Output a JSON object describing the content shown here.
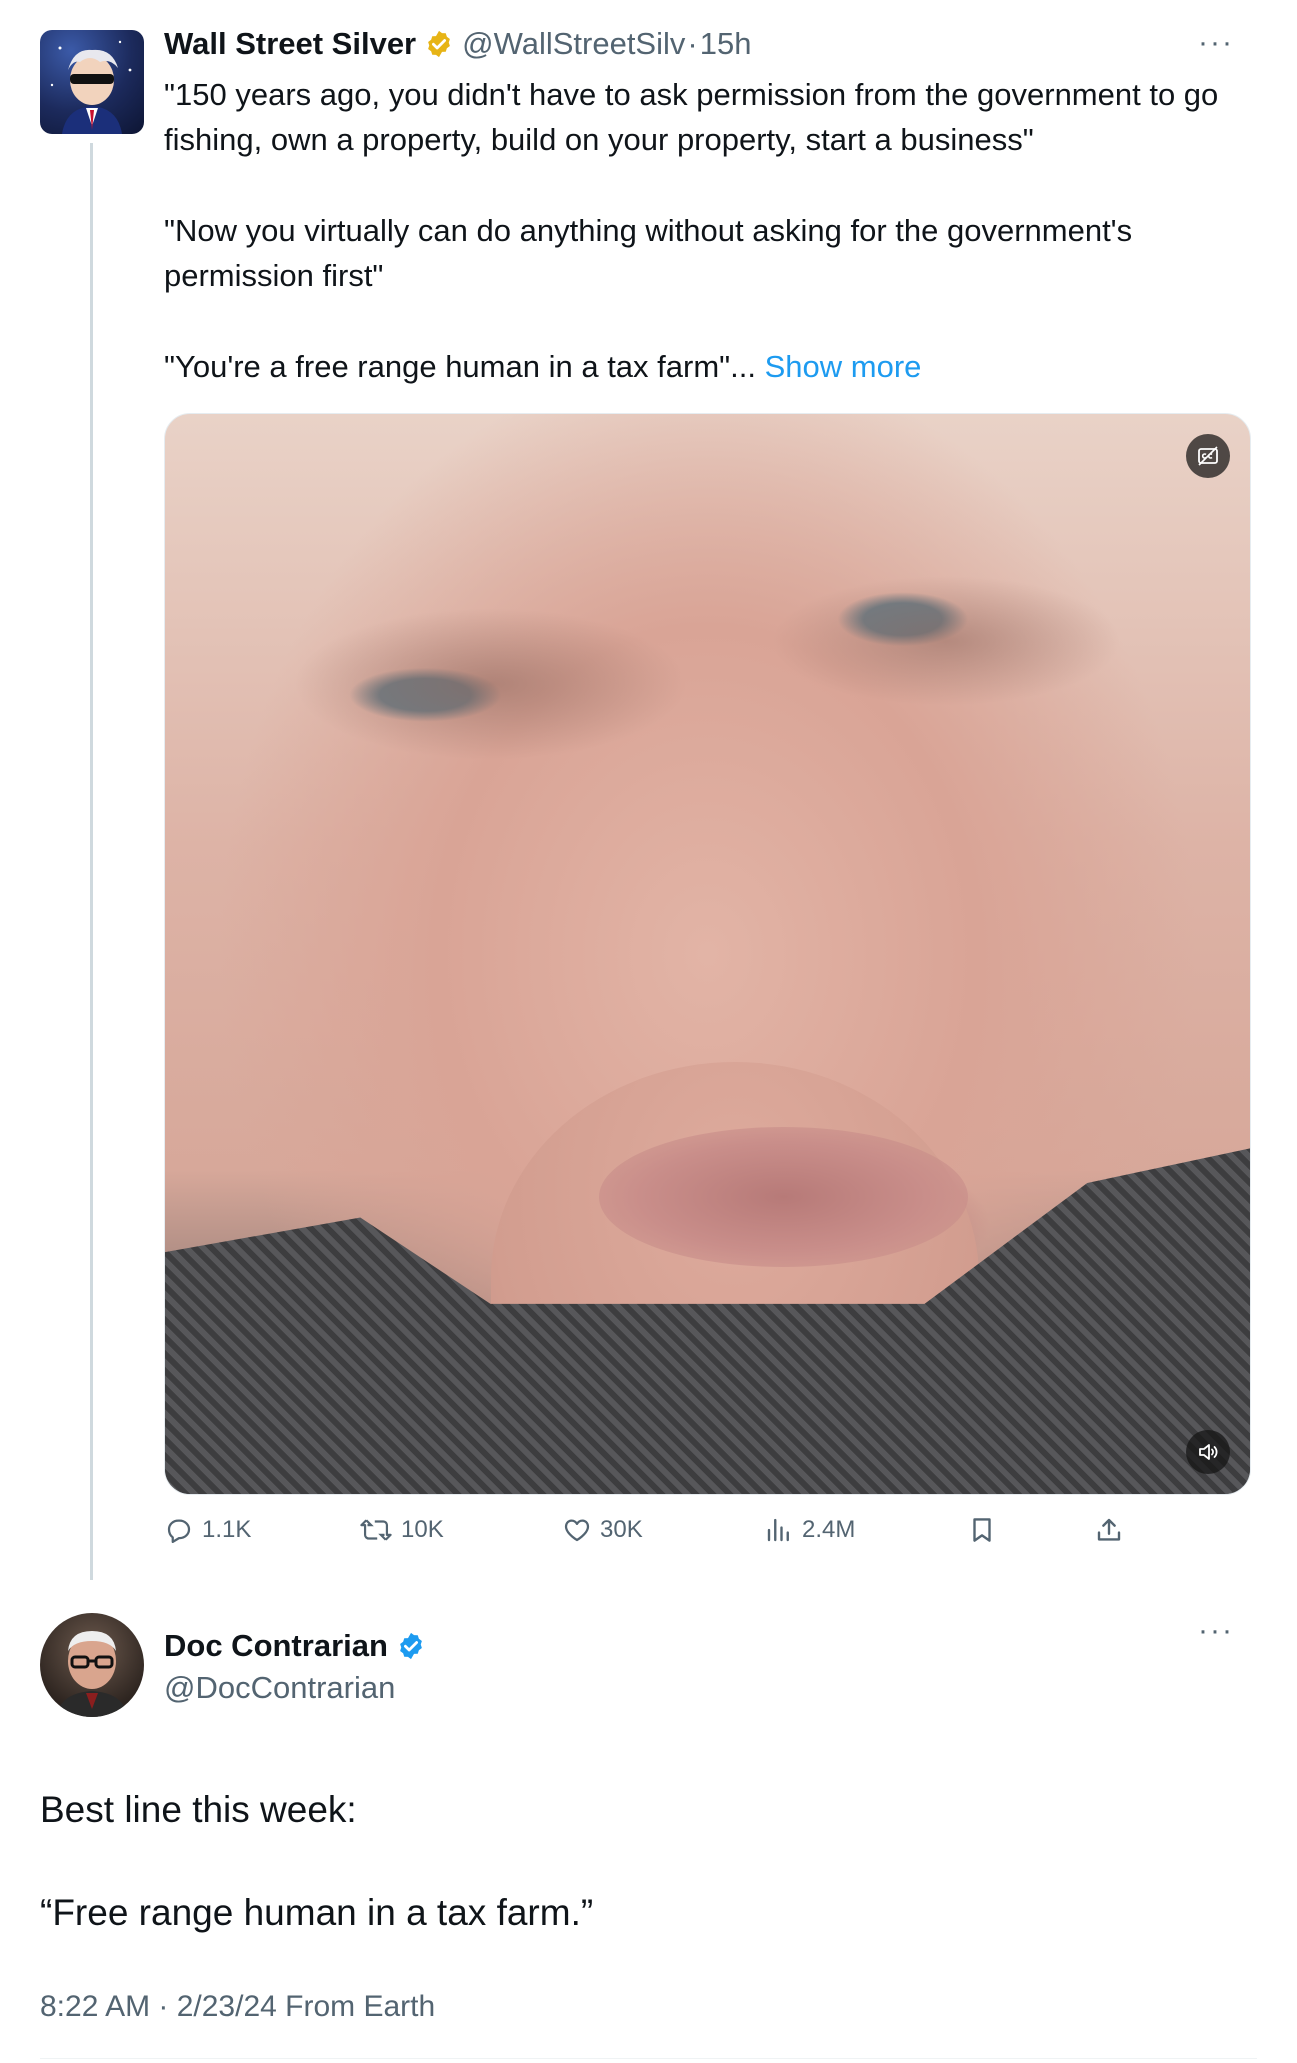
{
  "tweet": {
    "author_name": "Wall Street Silver",
    "author_handle": "@WallStreetSilv",
    "separator": "·",
    "time_ago": "15h",
    "verified_badge_color": "#e7b416",
    "paragraphs": [
      "\"150 years ago, you didn't have to ask permission from the government to go fishing, own a property, build on your property, start a business\"",
      "\"Now you virtually can do anything without asking for the government's permission first\"",
      "\"You're a free range human in a tax farm\"..."
    ],
    "show_more": "Show more",
    "actions": {
      "replies": "1.1K",
      "reposts": "10K",
      "likes": "30K",
      "views": "2.4M"
    }
  },
  "reply": {
    "author_name": "Doc Contrarian",
    "author_handle": "@DocContrarian",
    "verified_badge_color": "#1d9bf0",
    "lines": [
      "Best line this week:",
      "“Free range human in a tax farm.”"
    ],
    "timestamp": "8:22 AM · 2/23/24 From Earth"
  },
  "icons": {
    "more": "more-horizontal-icon",
    "reply": "reply-icon",
    "repost": "repost-icon",
    "like": "heart-icon",
    "views": "views-icon",
    "bookmark": "bookmark-icon",
    "share": "share-icon",
    "captions": "captions-icon",
    "volume": "volume-icon"
  },
  "colors": {
    "text": "#0f1419",
    "secondary": "#536471",
    "link": "#1d9bf0",
    "thread_line": "#cfd9de"
  }
}
